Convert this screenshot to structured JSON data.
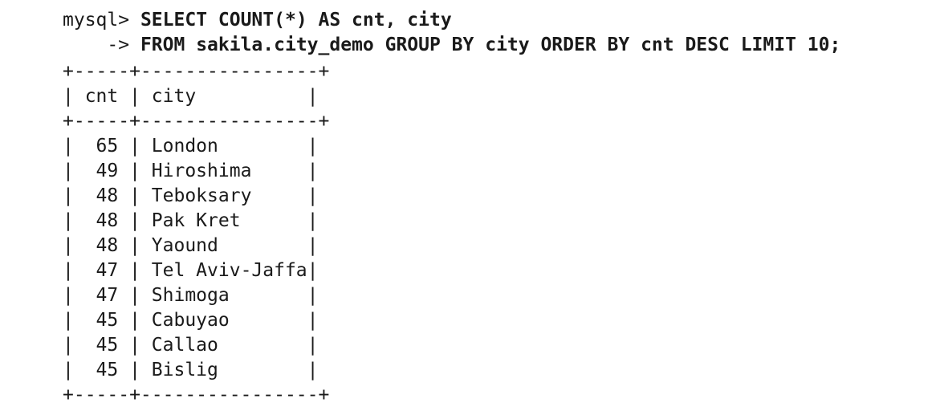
{
  "query": {
    "prompt": "mysql>",
    "line1": "SELECT COUNT(*) AS cnt, city",
    "continuation_prompt": "->",
    "line2": "FROM sakila.city_demo GROUP BY city ORDER BY cnt DESC LIMIT 10;"
  },
  "table": {
    "border": "+-----+----------------+",
    "columns": [
      "cnt",
      "city"
    ],
    "rows": [
      {
        "cnt": "65",
        "city": "London"
      },
      {
        "cnt": "49",
        "city": "Hiroshima"
      },
      {
        "cnt": "48",
        "city": "Teboksary"
      },
      {
        "cnt": "48",
        "city": "Pak Kret"
      },
      {
        "cnt": "48",
        "city": "Yaound"
      },
      {
        "cnt": "47",
        "city": "Tel Aviv-Jaffa"
      },
      {
        "cnt": "47",
        "city": "Shimoga"
      },
      {
        "cnt": "45",
        "city": "Cabuyao"
      },
      {
        "cnt": "45",
        "city": "Callao"
      },
      {
        "cnt": "45",
        "city": "Bislig"
      }
    ]
  }
}
